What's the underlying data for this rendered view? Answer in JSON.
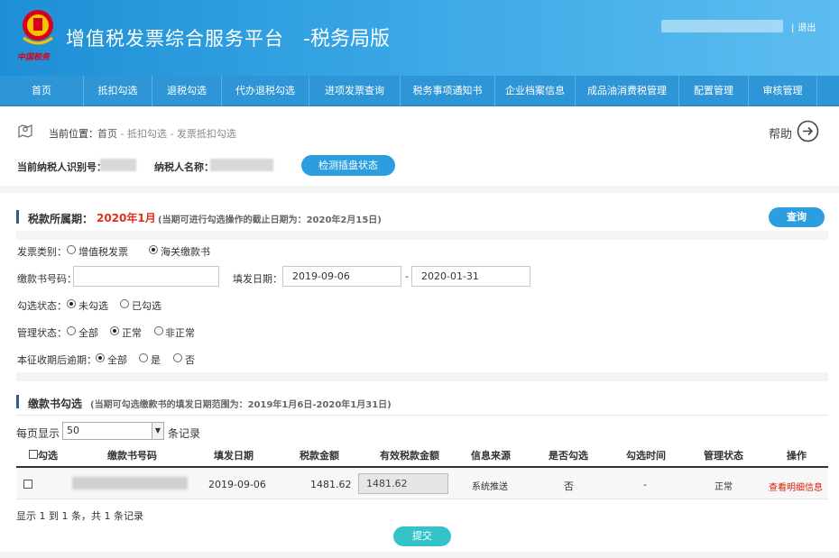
{
  "header": {
    "logo_text": "中国税务",
    "title": "增值税发票综合服务平台",
    "subtitle": "-税务局版",
    "logout_label": "退出",
    "separator": "|"
  },
  "nav": {
    "items": [
      {
        "label": "首页"
      },
      {
        "label": "抵扣勾选"
      },
      {
        "label": "退税勾选"
      },
      {
        "label": "代办退税勾选"
      },
      {
        "label": "进项发票查询"
      },
      {
        "label": "税务事项通知书"
      },
      {
        "label": "企业档案信息"
      },
      {
        "label": "成品油消费税管理"
      },
      {
        "label": "配置管理"
      },
      {
        "label": "审核管理"
      }
    ]
  },
  "location": {
    "label": "当前位置：",
    "crumb_home": "首页",
    "crumb_rest": " - 抵扣勾选 - 发票抵扣勾选",
    "help_label": "帮助",
    "taxpayer_id_label": "当前纳税人识别号：",
    "taxpayer_name_label": "纳税人名称：",
    "check_button": "检测插盘状态"
  },
  "period": {
    "label": "税款所属期：",
    "value": "2020年1月",
    "note": "(当期可进行勾选操作的截止日期为：2020年2月15日)",
    "query_button": "查询"
  },
  "form": {
    "invoice_type_label": "发票类别：",
    "invoice_type_options": [
      "增值税发票",
      "海关缴款书"
    ],
    "invoice_type_selected": 1,
    "payment_no_label": "缴款书号码：",
    "payment_no_value": "",
    "issue_date_label": "填发日期：",
    "date_from": "2019-09-06",
    "date_to": "2020-01-31",
    "date_sep": "-",
    "check_status_label": "勾选状态：",
    "check_status_options": [
      "未勾选",
      "已勾选"
    ],
    "check_status_selected": 0,
    "manage_status_label": "管理状态：",
    "manage_status_options": [
      "全部",
      "正常",
      "非正常"
    ],
    "manage_status_selected": 1,
    "overdue_label": "本征收期后逾期：",
    "overdue_options": [
      "全部",
      "是",
      "否"
    ],
    "overdue_selected": 0
  },
  "section2": {
    "label": "缴款书勾选",
    "note": "(当期可勾选缴款书的填发日期范围为：2019年1月6日-2020年1月31日)",
    "per_page_prefix": "每页显示",
    "per_page_value": "50",
    "per_page_suffix": "条记录"
  },
  "table": {
    "headers": [
      "勾选",
      "缴款书号码",
      "填发日期",
      "税款金额",
      "有效税款金额",
      "信息来源",
      "是否勾选",
      "勾选时间",
      "管理状态",
      "操作"
    ],
    "rows": [
      {
        "issue_date": "2019-09-06",
        "tax_amount": "1481.62",
        "valid_tax_amount": "1481.62",
        "source": "系统推送",
        "is_checked": "否",
        "check_time": "-",
        "manage_status": "正常",
        "action": "查看明细信息"
      }
    ],
    "summary": "显示 1 到 1 条，共 1 条记录",
    "submit_button": "提交"
  }
}
